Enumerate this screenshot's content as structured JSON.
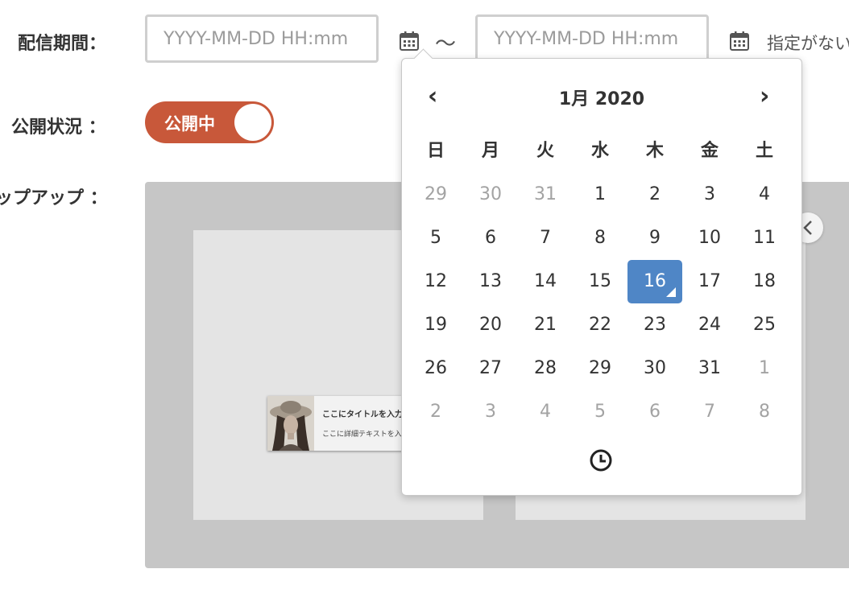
{
  "form": {
    "period_label": "配信期間：",
    "status_label": "公開状況 ：",
    "popup_label": "ップアップ ：",
    "start_placeholder": "YYYY-MM-DD HH:mm",
    "end_placeholder": "YYYY-MM-DD HH:mm",
    "range_separator": "〜",
    "unspecified_label": "指定がない",
    "toggle_label": "公開中",
    "toggle_on": true,
    "toggle_color": "#c8583a"
  },
  "preview": {
    "banner_title": "ここにタイトルを入力してくだ",
    "banner_text": "ここに詳細テキストを入力してくだ"
  },
  "datepicker": {
    "title": "1月 2020",
    "prev_label": "‹",
    "next_label": "›",
    "weekdays": [
      "日",
      "月",
      "火",
      "水",
      "木",
      "金",
      "土"
    ],
    "weeks": [
      [
        {
          "d": "29",
          "m": true
        },
        {
          "d": "30",
          "m": true
        },
        {
          "d": "31",
          "m": true
        },
        {
          "d": "1"
        },
        {
          "d": "2"
        },
        {
          "d": "3"
        },
        {
          "d": "4"
        }
      ],
      [
        {
          "d": "5"
        },
        {
          "d": "6"
        },
        {
          "d": "7"
        },
        {
          "d": "8"
        },
        {
          "d": "9"
        },
        {
          "d": "10"
        },
        {
          "d": "11"
        }
      ],
      [
        {
          "d": "12"
        },
        {
          "d": "13"
        },
        {
          "d": "14"
        },
        {
          "d": "15"
        },
        {
          "d": "16",
          "s": true
        },
        {
          "d": "17"
        },
        {
          "d": "18"
        }
      ],
      [
        {
          "d": "19"
        },
        {
          "d": "20"
        },
        {
          "d": "21"
        },
        {
          "d": "22"
        },
        {
          "d": "23"
        },
        {
          "d": "24"
        },
        {
          "d": "25"
        }
      ],
      [
        {
          "d": "26"
        },
        {
          "d": "27"
        },
        {
          "d": "28"
        },
        {
          "d": "29"
        },
        {
          "d": "30"
        },
        {
          "d": "31"
        },
        {
          "d": "1",
          "m": true
        }
      ],
      [
        {
          "d": "2",
          "m": true
        },
        {
          "d": "3",
          "m": true
        },
        {
          "d": "4",
          "m": true
        },
        {
          "d": "5",
          "m": true
        },
        {
          "d": "6",
          "m": true
        },
        {
          "d": "7",
          "m": true
        },
        {
          "d": "8",
          "m": true
        }
      ]
    ],
    "selected_color": "#4f86c6",
    "time_icon": "clock-icon"
  }
}
